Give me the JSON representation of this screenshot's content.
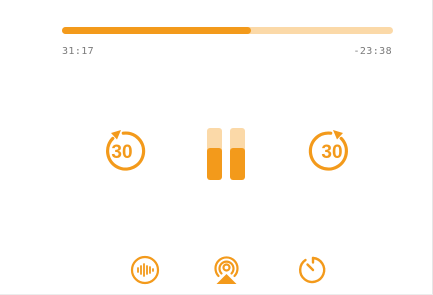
{
  "colors": {
    "accent": "#f39a1b",
    "accent_light": "#fbd9a8",
    "time_text": "#7a7a7a",
    "background": "#ffffff"
  },
  "progress": {
    "elapsed": "31:17",
    "remaining": "-23:38",
    "fraction": 0.57
  },
  "controls": {
    "skip_back": {
      "label": "30",
      "icon": "rewind-30-icon"
    },
    "play_pause": {
      "state": "playing",
      "icon": "pause-icon"
    },
    "skip_forward": {
      "label": "30",
      "icon": "forward-30-icon"
    }
  },
  "bottom_bar": [
    {
      "icon": "playback-speed-icon"
    },
    {
      "icon": "airplay-icon"
    },
    {
      "icon": "sleep-timer-icon"
    }
  ]
}
